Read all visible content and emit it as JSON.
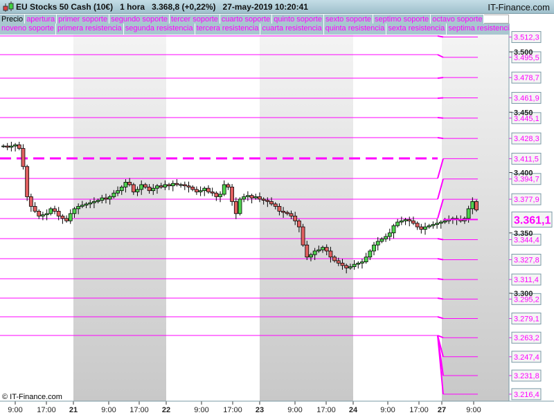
{
  "title": {
    "instrument": "EU Stocks 50 Cash (10€)",
    "timeframe": "1 hora",
    "price": "3.368,8 (+0,22%)",
    "datetime": "27-may-2019 10:20:41",
    "brand": "IT-Finance.com"
  },
  "legend_row1": [
    "Precio",
    "apertura",
    "primer soporte",
    "segundo soporte",
    "tercer soporte",
    "cuarto soporte",
    "quinto soporte",
    "sexto soporte",
    "septimo soporte",
    "octavo soporte"
  ],
  "legend_row2": [
    "noveno soporte",
    "primera resistencia",
    "segunda resistencia",
    "tercera resistencia",
    "cuarta resistencia",
    "quinta resistencia",
    "sexta resistencia",
    "septima resistencia"
  ],
  "credit": "© IT-Finance.com",
  "colors": {
    "level": "#ff00ff",
    "up": "#4fd24f",
    "down": "#e06060"
  },
  "chart_data": {
    "type": "candlestick",
    "y_ticks": [
      "3.500",
      "3.450",
      "3.400",
      "3.350",
      "3.300"
    ],
    "y_tick_values": [
      3500,
      3450,
      3400,
      3350,
      3300
    ],
    "x_labels": [
      "9:00",
      "17:00",
      "21",
      "9:00",
      "17:00",
      "22",
      "9:00",
      "17:00",
      "23",
      "9:00",
      "17:00",
      "24",
      "9:00",
      "17:00",
      "27",
      "9:00"
    ],
    "levels": [
      "3.512,3",
      "3.495,5",
      "3.478,7",
      "3.461,9",
      "3.445,1",
      "3.428,3",
      "3.411,5",
      "3.394,7",
      "3.377,9",
      "3.344,4",
      "3.327,8",
      "3.311,4",
      "3.295,2",
      "3.279,1",
      "3.263,2",
      "3.247,4",
      "3.231,8",
      "3.216,4"
    ],
    "level_values": [
      3512.3,
      3495.5,
      3478.7,
      3461.9,
      3445.1,
      3428.3,
      3411.5,
      3394.7,
      3377.9,
      3344.4,
      3327.8,
      3311.4,
      3295.2,
      3279.1,
      3263.2,
      3247.4,
      3231.8,
      3216.4
    ],
    "current_price": "3.361,1",
    "current_value": 3361.1,
    "opening_level": 3411.7,
    "closes": [
      3422,
      3421,
      3422,
      3423,
      3420,
      3405,
      3380,
      3372,
      3368,
      3364,
      3365,
      3366,
      3370,
      3368,
      3364,
      3362,
      3360,
      3366,
      3370,
      3372,
      3373,
      3374,
      3375,
      3376,
      3377,
      3379,
      3378,
      3380,
      3383,
      3385,
      3388,
      3392,
      3390,
      3384,
      3386,
      3390,
      3388,
      3385,
      3387,
      3389,
      3388,
      3390,
      3389,
      3391,
      3390,
      3390,
      3389,
      3388,
      3386,
      3384,
      3385,
      3387,
      3384,
      3383,
      3380,
      3382,
      3390,
      3388,
      3376,
      3366,
      3378,
      3380,
      3381,
      3379,
      3380,
      3378,
      3377,
      3376,
      3374,
      3372,
      3368,
      3367,
      3366,
      3364,
      3360,
      3355,
      3340,
      3330,
      3332,
      3335,
      3336,
      3338,
      3335,
      3330,
      3327,
      3325,
      3323,
      3321,
      3322,
      3324,
      3325,
      3326,
      3330,
      3335,
      3340,
      3343,
      3345,
      3347,
      3350,
      3356,
      3359,
      3360,
      3361,
      3360,
      3358,
      3355,
      3353,
      3355,
      3356,
      3357,
      3358,
      3359,
      3360,
      3361,
      3362,
      3361,
      3360,
      3362,
      3370,
      3376,
      3369
    ]
  }
}
